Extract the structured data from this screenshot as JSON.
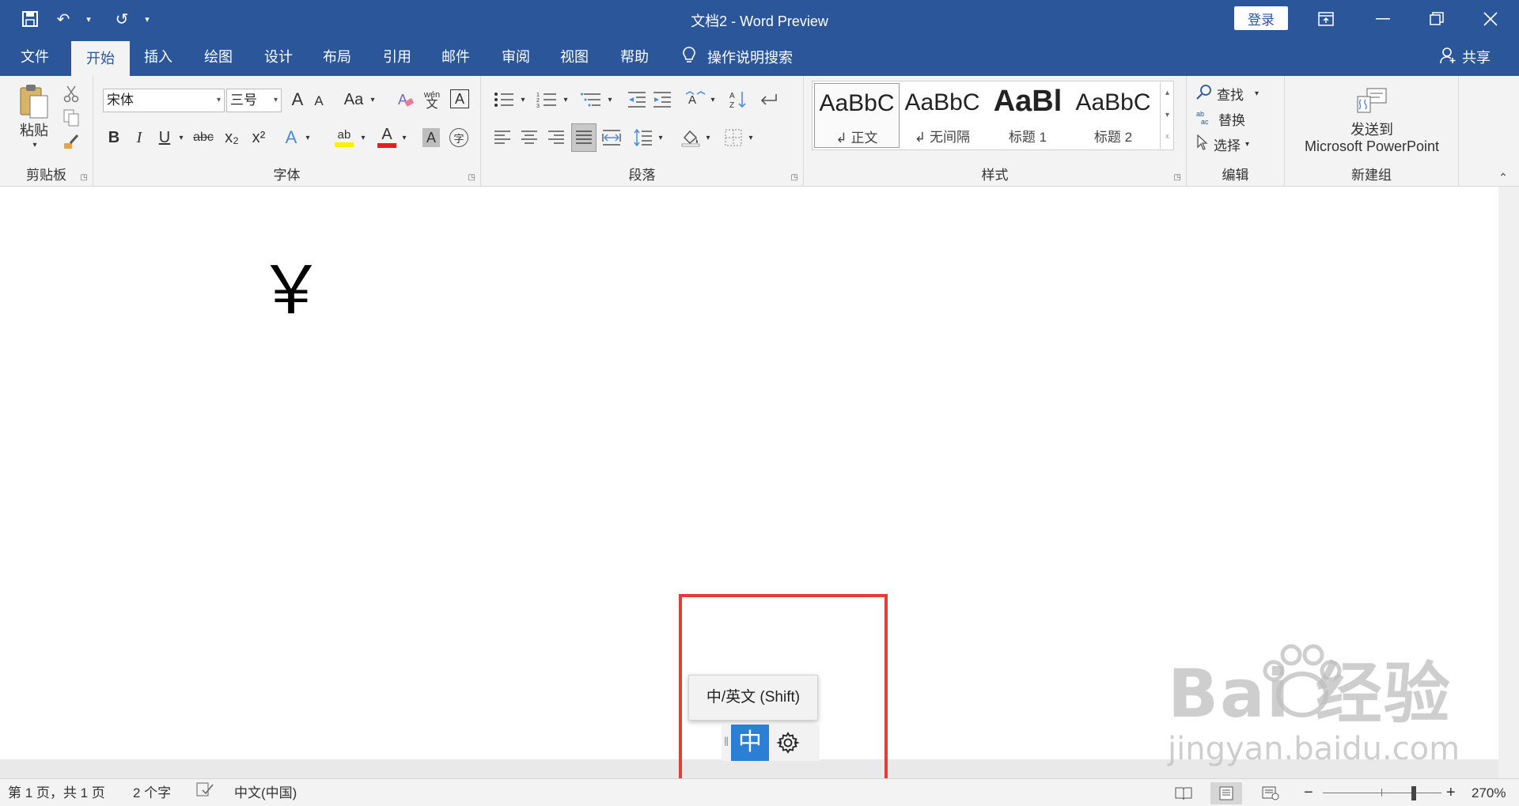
{
  "window": {
    "title": "文档2 - Word Preview",
    "login_label": "登录",
    "controls": {
      "ribbon_display": "⊡",
      "minimize": "—",
      "restore": "❐",
      "close": "✕"
    }
  },
  "quick_access": {
    "save": "🖫",
    "undo": "↶",
    "redo": "↺",
    "customize": "▾"
  },
  "tabs": [
    {
      "label": "文件"
    },
    {
      "label": "开始"
    },
    {
      "label": "插入"
    },
    {
      "label": "绘图"
    },
    {
      "label": "设计"
    },
    {
      "label": "布局"
    },
    {
      "label": "引用"
    },
    {
      "label": "邮件"
    },
    {
      "label": "审阅"
    },
    {
      "label": "视图"
    },
    {
      "label": "帮助"
    }
  ],
  "tell_me": "操作说明搜索",
  "share": "共享",
  "ribbon": {
    "clipboard": {
      "paste_label": "粘贴",
      "group_label": "剪贴板"
    },
    "font": {
      "group_label": "字体",
      "font_name": "宋体",
      "font_size": "三号",
      "grow": "A",
      "shrink": "A",
      "change_case": "Aa",
      "phonetic_top": "wén",
      "phonetic_bottom": "文",
      "char_border": "A",
      "bold": "B",
      "italic": "I",
      "underline": "U",
      "strike": "abc",
      "subscript": "x₂",
      "superscript": "x²",
      "text_effect": "A",
      "highlight": "ab",
      "font_color": "A",
      "char_shading": "A",
      "enclose": "字"
    },
    "paragraph": {
      "group_label": "段落"
    },
    "styles": {
      "group_label": "样式",
      "items": [
        {
          "sample": "AaBbC",
          "name": "↲ 正文"
        },
        {
          "sample": "AaBbC",
          "name": "↲ 无间隔"
        },
        {
          "sample": "AaBl",
          "name": "标题 1"
        },
        {
          "sample": "AaBbC",
          "name": "标题 2"
        }
      ]
    },
    "editing": {
      "group_label": "编辑",
      "find": "查找",
      "replace": "替换",
      "select": "选择"
    },
    "new_group": {
      "group_label": "新建组",
      "send_line1": "发送到",
      "send_line2": "Microsoft PowerPoint"
    }
  },
  "document": {
    "content": "￥"
  },
  "ime": {
    "tooltip": "中/英文 (Shift)",
    "mode": "中"
  },
  "status": {
    "page": "第 1 页，共 1 页",
    "words": "2 个字",
    "language": "中文(中国)",
    "zoom_minus": "−",
    "zoom_plus": "+",
    "zoom": "270%",
    "zoom_level": 0.78
  },
  "watermark": {
    "brand": "Bai  经验",
    "url": "jingyan.baidu.com"
  },
  "colors": {
    "accent": "#2b579a",
    "ime_active": "#2b7fd4",
    "highlight_box": "#e8393b"
  }
}
